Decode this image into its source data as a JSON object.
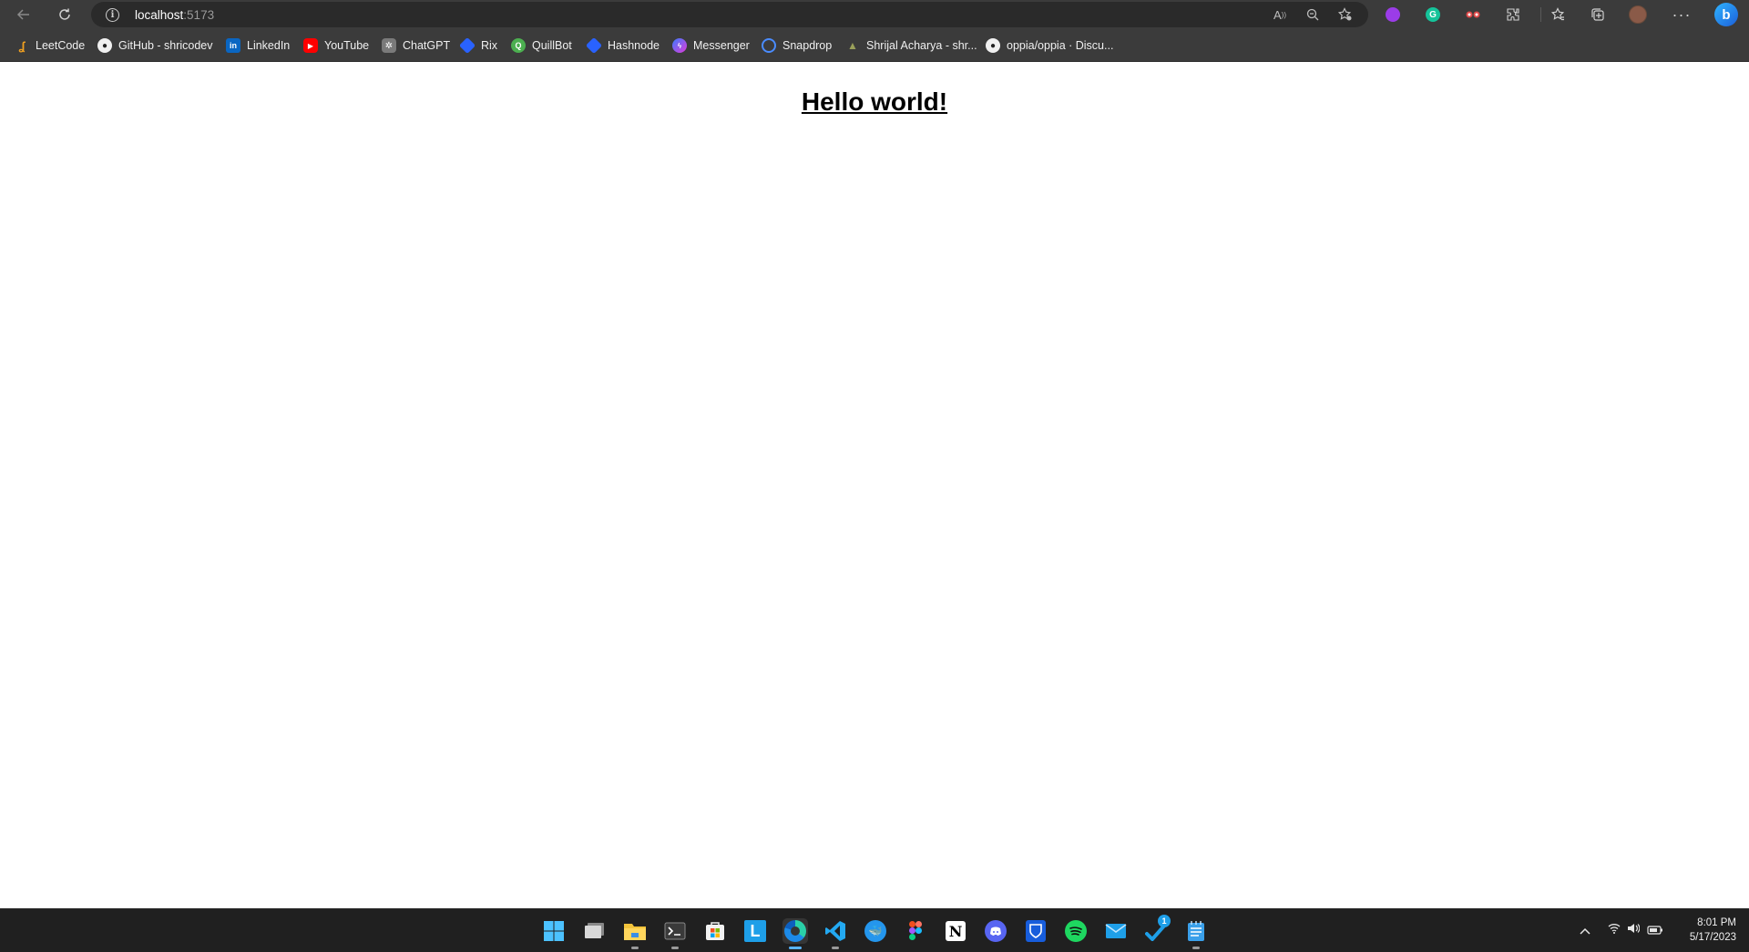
{
  "browser": {
    "address": {
      "host": "localhost",
      "port": ":5173"
    },
    "bookmarks": [
      {
        "label": "LeetCode",
        "icon": "leetcode-icon",
        "color": "#f0a020"
      },
      {
        "label": "GitHub - shricodev",
        "icon": "github-icon",
        "color": "#f0f0f0"
      },
      {
        "label": "LinkedIn",
        "icon": "linkedin-icon",
        "color": "#0a66c2"
      },
      {
        "label": "YouTube",
        "icon": "youtube-icon",
        "color": "#ff0000"
      },
      {
        "label": "ChatGPT",
        "icon": "chatgpt-icon",
        "color": "#7a7a7a"
      },
      {
        "label": "Rix",
        "icon": "rix-icon",
        "color": "#2962ff"
      },
      {
        "label": "QuillBot",
        "icon": "quillbot-icon",
        "color": "#4caf50"
      },
      {
        "label": "Hashnode",
        "icon": "hashnode-icon",
        "color": "#2962ff"
      },
      {
        "label": "Messenger",
        "icon": "messenger-icon",
        "color": "#a033ff"
      },
      {
        "label": "Snapdrop",
        "icon": "snapdrop-icon",
        "color": "#4a8cff"
      },
      {
        "label": "Shrijal Acharya - shr...",
        "icon": "profile-site-icon",
        "color": "#9aa05a"
      },
      {
        "label": "oppia/oppia · Discu...",
        "icon": "github-icon",
        "color": "#f0f0f0"
      }
    ]
  },
  "page": {
    "heading": "Hello world!"
  },
  "taskbar": {
    "clock_time": "8:01 PM",
    "clock_date": "5/17/2023",
    "badge": "1"
  },
  "colors": {
    "chrome": "#3b3b3b",
    "taskbar": "#202020",
    "accent": "#58b4ff"
  }
}
